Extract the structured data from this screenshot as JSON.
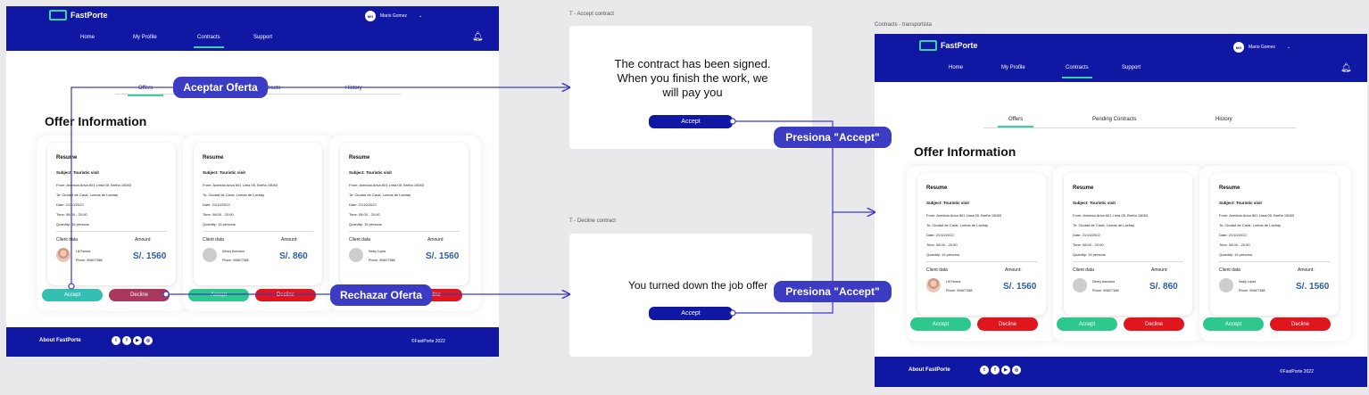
{
  "app": {
    "brand": "FastPorte",
    "user_initials": "MG",
    "user_name": "Mario Gomez",
    "nav": [
      "Home",
      "My Profile",
      "Contracts",
      "Support"
    ],
    "tabs": [
      "Offers",
      "Pending Contracts",
      "History"
    ],
    "section_title": "Offer Information",
    "cards": [
      {
        "resume": "Resume",
        "subject": "Subject: Touristic visit",
        "from": "From: Avenida Arica 601 Lima 05, Breña 15083",
        "to": "To:  Ciudad de Caral, Lomas de Lachay",
        "date": "Date: 21/10/2022",
        "time": "Time: 08:00 - 20:00",
        "quantity": "Quantity: 15 persons",
        "client_label": "Client data",
        "amount_label": "Amount:",
        "client_name": "Lili Ramos",
        "client_phone": "Phone: 906677665",
        "amount": "S/. 1560",
        "accept": "Accept",
        "decline": "Decline"
      },
      {
        "resume": "Resume",
        "subject": "Subject: Touristic visit",
        "from": "From: Avenida Arica 601 Lima 05, Breña 15083",
        "to": "To:  Ciudad de Caral, Lomas de Lachay",
        "date": "Date: 21/10/2022",
        "time": "Time: 08:00 - 20:00",
        "quantity": "Quantity: 15 persons",
        "client_label": "Client data",
        "amount_label": "Amount:",
        "client_name": "Dénny Asencios",
        "client_phone": "Phone: 906677665",
        "amount": "S/. 860",
        "accept": "Accept",
        "decline": "Decline"
      },
      {
        "resume": "Resume",
        "subject": "Subject: Touristic visit",
        "from": "From: Avenida Arica 601 Lima 05, Breña 15083",
        "to": "To:  Ciudad de Caral, Lomas de Lachay",
        "date": "Date: 21/10/2022",
        "time": "Time: 08:00 - 20:00",
        "quantity": "Quantity: 15 persons",
        "client_label": "Client data",
        "amount_label": "Amount:",
        "client_name": "Sealy Lopez",
        "client_phone": "Phone: 906677665",
        "amount": "S/. 1560",
        "accept": "Accept",
        "decline": "Decline"
      }
    ],
    "footer_about": "About FastPorte",
    "footer_copy": "©FastPorte 2022",
    "social_icons": [
      "twitter-icon",
      "facebook-icon",
      "youtube-icon",
      "instagram-icon"
    ]
  },
  "frames": {
    "accept_label": "T - Accept contract",
    "decline_label": "T - Decline contract",
    "result_label": "Contracts - transportista"
  },
  "accept_modal": {
    "message": "The contract has been signed. When you finish the work, we will pay you",
    "button": "Accept"
  },
  "decline_modal": {
    "message": "You turned down the job offer",
    "button": "Accept"
  },
  "callouts": {
    "accept_offer": "Aceptar Oferta",
    "reject_offer": "Rechazar Oferta",
    "press_accept_1": "Presiona \"Accept\"",
    "press_accept_2": "Presiona \"Accept\""
  },
  "colors": {
    "brand": "#0f17a3",
    "accent": "#2ec88f",
    "decline": "#e0161f",
    "callout": "#3b3bc4",
    "amount": "#2c5ea8"
  }
}
